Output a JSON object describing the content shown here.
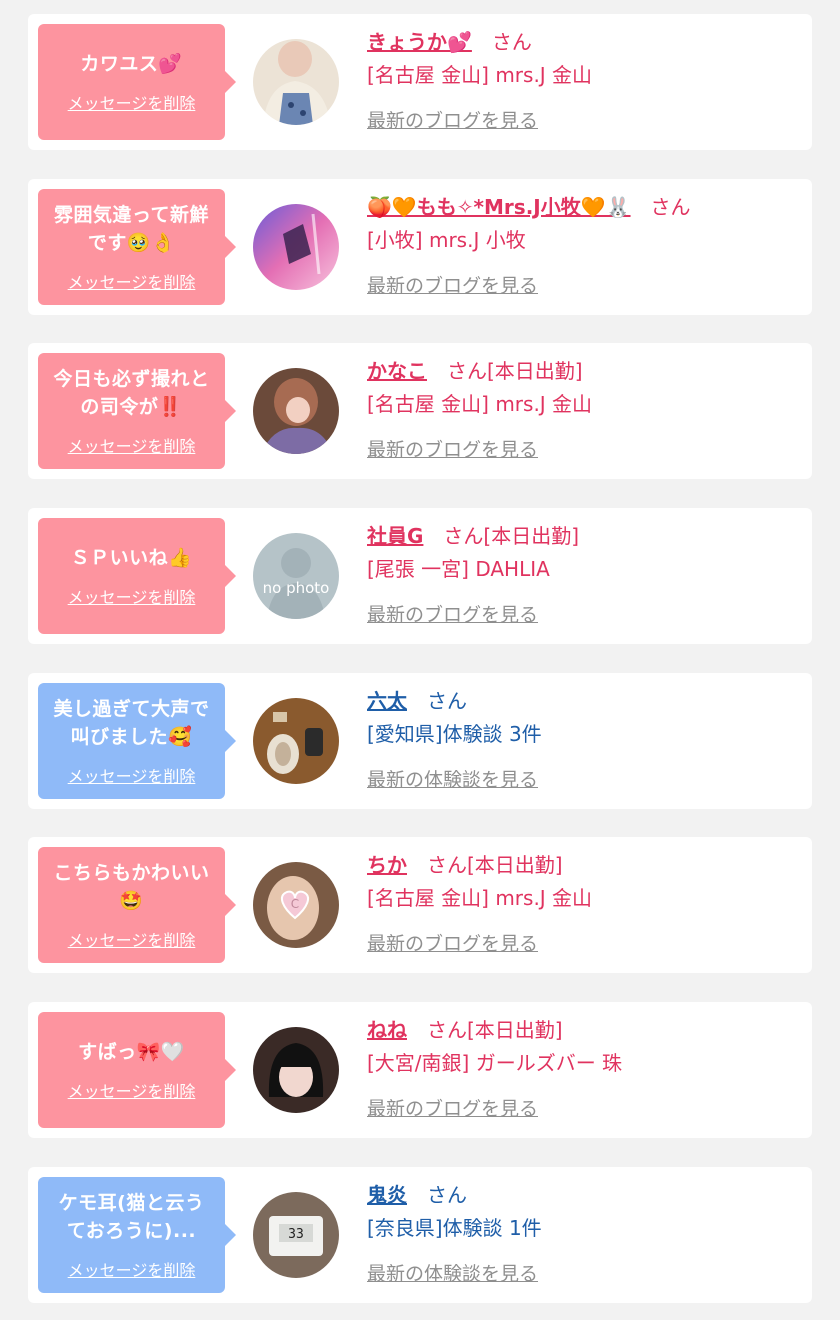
{
  "delete_label": "メッセージを削除",
  "san_label": "さん",
  "colors": {
    "pink_bubble": "#fd949f",
    "blue_bubble": "#8fbaf8",
    "pink_text": "#e0335f",
    "blue_text": "#1f5ea8",
    "link_gray": "#8f8f8f"
  },
  "entries": [
    {
      "type": "pink",
      "message": "カワユス💕",
      "name": "きょうか💕",
      "san": "さん",
      "status": "",
      "shop": "[名古屋 金山] mrs.J 金山",
      "link": "最新のブログを見る",
      "avatar_icon": "avatar-photo"
    },
    {
      "type": "pink",
      "message": "雰囲気違って新鮮\nです🥹👌",
      "name": "🍑🧡もも✧*Mrs.J小牧🧡🐰",
      "san": "さん",
      "status": "",
      "shop": "[小牧] mrs.J 小牧",
      "link": "最新のブログを見る",
      "avatar_icon": "avatar-photo"
    },
    {
      "type": "pink",
      "message": "今日も必ず撮れと\nの司令が‼️",
      "name": "かなこ",
      "san": "さん",
      "status": "[本日出勤]",
      "shop": "[名古屋 金山] mrs.J 金山",
      "link": "最新のブログを見る",
      "avatar_icon": "avatar-photo"
    },
    {
      "type": "pink",
      "message": "ＳＰいいね👍",
      "name": "社員G",
      "san": "さん",
      "status": "[本日出勤]",
      "shop": "[尾張 一宮] DAHLIA",
      "link": "最新のブログを見る",
      "avatar_icon": "no-photo-avatar"
    },
    {
      "type": "blue",
      "message": "美し過ぎて大声で\n叫びました🥰",
      "name": "六太",
      "san": "さん",
      "status": "",
      "shop": "[愛知県]体験談 3件",
      "link": "最新の体験談を見る",
      "avatar_icon": "avatar-photo"
    },
    {
      "type": "pink",
      "message": "こちらもかわいい\n🤩",
      "name": "ちか",
      "san": "さん",
      "status": "[本日出勤]",
      "shop": "[名古屋 金山] mrs.J 金山",
      "link": "最新のブログを見る",
      "avatar_icon": "avatar-photo"
    },
    {
      "type": "pink",
      "message": "すばっ🎀🤍",
      "name": "ねね",
      "san": "さん",
      "status": "[本日出勤]",
      "shop": "[大宮/南銀] ガールズバー 珠",
      "link": "最新のブログを見る",
      "avatar_icon": "avatar-photo"
    },
    {
      "type": "blue",
      "message": "ケモ耳(猫と云う\nておろうに)...",
      "name": "鬼炎",
      "san": "さん",
      "status": "",
      "shop": "[奈良県]体験談 1件",
      "link": "最新の体験談を見る",
      "avatar_icon": "avatar-photo"
    }
  ],
  "no_photo_text": "no photo"
}
